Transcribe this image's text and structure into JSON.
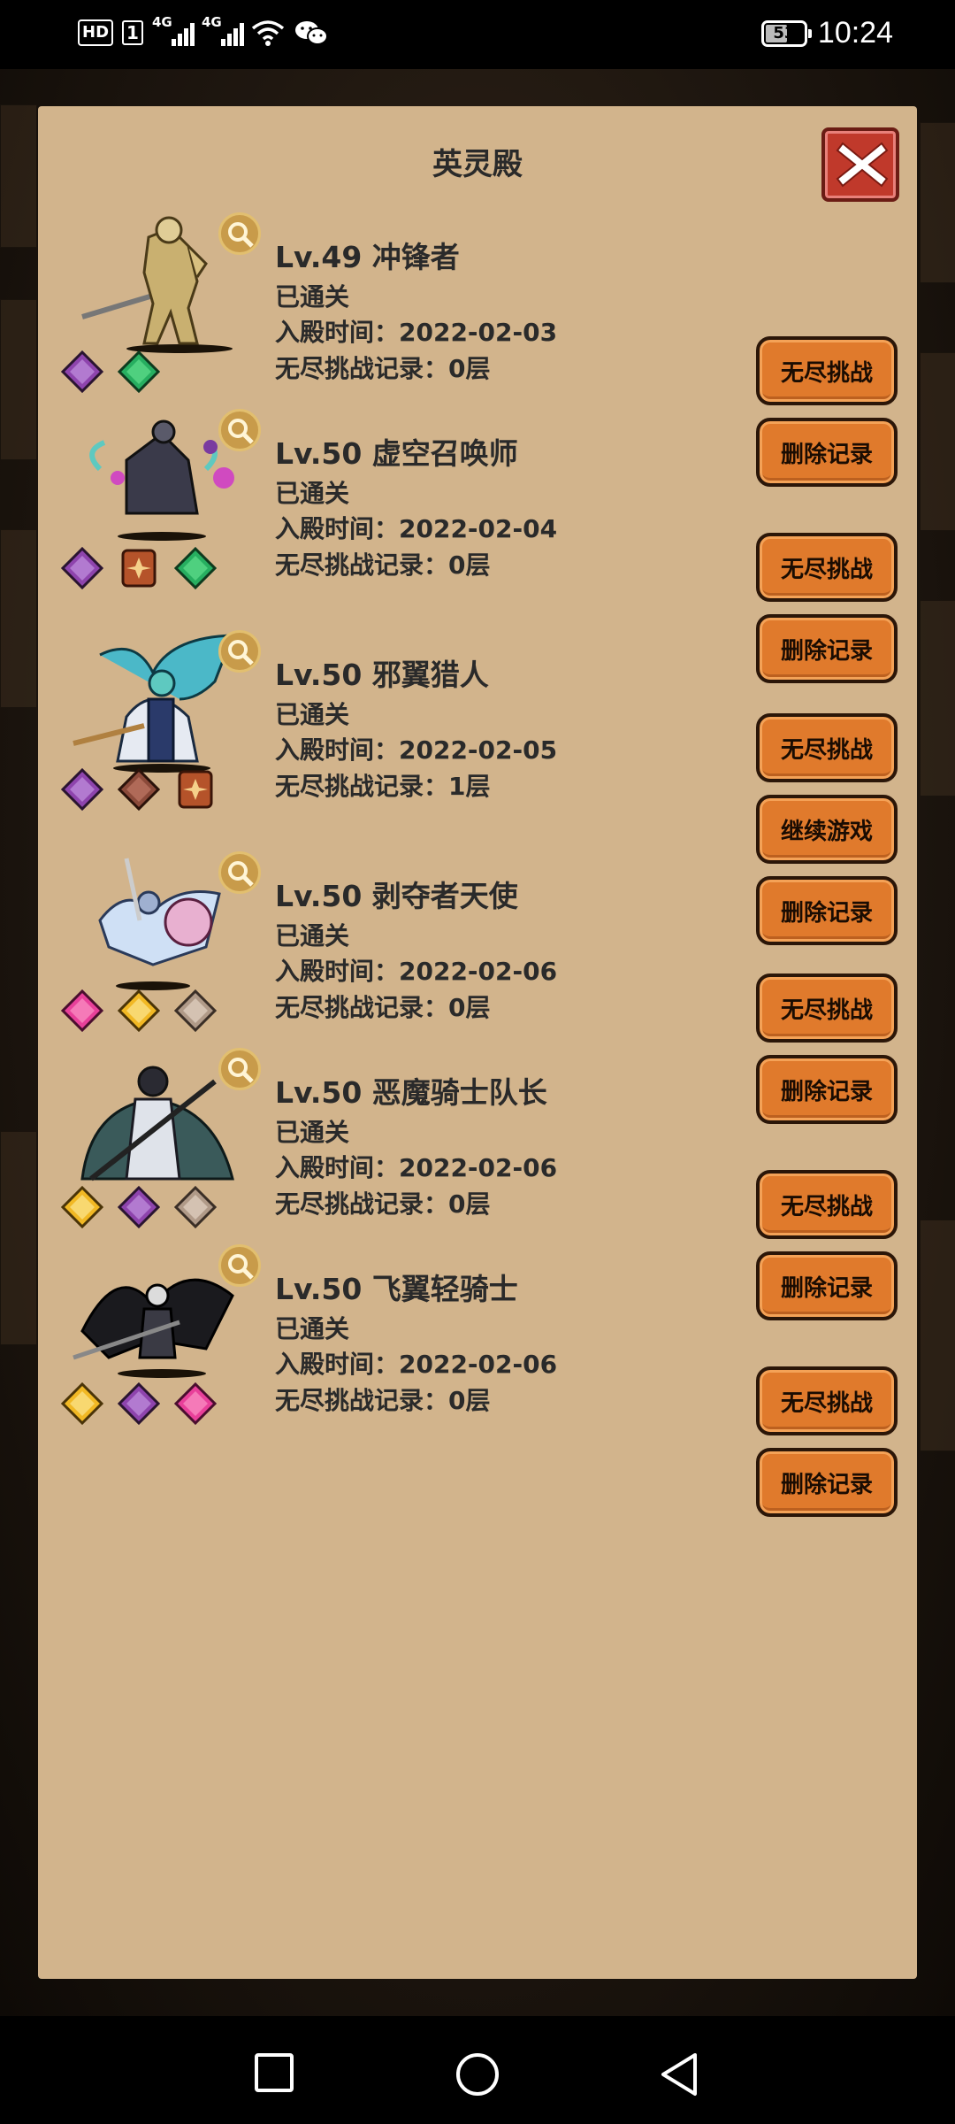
{
  "status_bar": {
    "hd": "HD",
    "sim": "1",
    "net1": "4G",
    "net2": "4G",
    "battery": "53",
    "time": "10:24"
  },
  "panel": {
    "title": "英灵殿"
  },
  "heroes": [
    {
      "name": "Lv.49 冲锋者",
      "status": "已通关",
      "date": "入殿时间：2022-02-03",
      "record": "无尽挑战记录：0层",
      "gems": [
        "purple",
        "green"
      ],
      "buttons": [
        "无尽挑战",
        "删除记录"
      ]
    },
    {
      "name": "Lv.50 虚空召唤师",
      "status": "已通关",
      "date": "入殿时间：2022-02-04",
      "record": "无尽挑战记录：0层",
      "gems": [
        "purple",
        "rune",
        "green"
      ],
      "buttons": [
        "无尽挑战",
        "删除记录"
      ]
    },
    {
      "name": "Lv.50 邪翼猎人",
      "status": "已通关",
      "date": "入殿时间：2022-02-05",
      "record": "无尽挑战记录：1层",
      "gems": [
        "purple",
        "brown",
        "rune"
      ],
      "buttons": [
        "无尽挑战",
        "继续游戏",
        "删除记录"
      ]
    },
    {
      "name": "Lv.50 剥夺者天使",
      "status": "已通关",
      "date": "入殿时间：2022-02-06",
      "record": "无尽挑战记录：0层",
      "gems": [
        "pink",
        "yellow",
        "gray"
      ],
      "buttons": [
        "无尽挑战",
        "删除记录"
      ]
    },
    {
      "name": "Lv.50 恶魔骑士队长",
      "status": "已通关",
      "date": "入殿时间：2022-02-06",
      "record": "无尽挑战记录：0层",
      "gems": [
        "yellow",
        "purple",
        "gray"
      ],
      "buttons": [
        "无尽挑战",
        "删除记录"
      ]
    },
    {
      "name": "Lv.50 飞翼轻骑士",
      "status": "已通关",
      "date": "入殿时间：2022-02-06",
      "record": "无尽挑战记录：0层",
      "gems": [
        "yellow",
        "purple",
        "pink"
      ],
      "buttons": [
        "无尽挑战",
        "删除记录"
      ]
    }
  ],
  "colors": {
    "panel": "#d2b48c",
    "button": "#e07a2c",
    "close": "#c0392b",
    "gem_purple": "#8e44ad",
    "gem_green": "#27ae60",
    "gem_pink": "#e8409a",
    "gem_yellow": "#f1b824",
    "gem_gray": "#b09a88",
    "gem_brown": "#8b4a3a",
    "gem_rune": "#b5532a"
  },
  "nav": {
    "icons": [
      "recent-apps-icon",
      "home-icon",
      "back-icon"
    ]
  }
}
